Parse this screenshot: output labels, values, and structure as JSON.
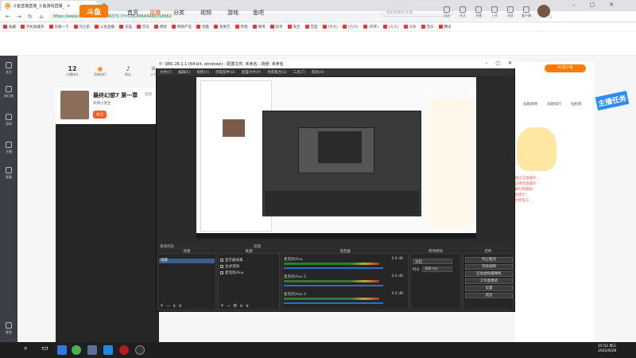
{
  "browser": {
    "tab_title": "斗鱼直播直播_斗鱼游戏直播_",
    "url": "https://www.douyu.com/5246371 /?=0.8149643445318662",
    "bookmarks": [
      "收藏",
      "手机收藏夹",
      "谷歌一下",
      "闪之航",
      "斗鱼直播",
      "天猫",
      "京东",
      "携程",
      "网易严选",
      "优酷",
      "爱奇艺",
      "哔哩",
      "微博",
      "知乎",
      "淘宝",
      "百度",
      "(大大)",
      "(六六)",
      "(开开)",
      "(人人)",
      "头条",
      "音乐",
      "腾讯"
    ]
  },
  "site": {
    "logo": "斗鱼",
    "nav": [
      "首页",
      "直播",
      "分类",
      "视频",
      "游戏",
      "鱼吧"
    ],
    "search_placeholder": "搜索直播间/主播",
    "header_icons": [
      "历史",
      "关注",
      "开播",
      "上传",
      "消息",
      "客户端"
    ],
    "sidebar": [
      "关注",
      "排行榜",
      "游戏",
      "主播",
      "赛事",
      "更多"
    ],
    "stats": [
      {
        "value": "12",
        "label": "主播排名"
      },
      {
        "value": "",
        "label": "贡献排行"
      },
      {
        "value": "",
        "label": "粉丝"
      },
      {
        "value": "",
        "label": "火力"
      }
    ],
    "room_title": "最终幻想7 第一章",
    "room_tag": "游戏",
    "anchor_name": "纯情小男生",
    "follow_label": "关注",
    "pc_client": "PC客户端",
    "right_tabs": [
      "贡献周榜",
      "贡献排行",
      "钻粉周"
    ],
    "promo_text": "主播任务",
    "chat_lines": [
      "主播正在直播中...",
      "欢迎来到直播间",
      "弹幕礼物播报",
      "斗鱼提示：",
      "请文明发言"
    ]
  },
  "obs": {
    "title": "OBS 26.1.1 (64-bit, windows) - 配置文件: 未命名 - 场景: 未命名",
    "menu": [
      "文件(F)",
      "编辑(E)",
      "视图(V)",
      "停靠部件(D)",
      "配置文件(P)",
      "场景集合(S)",
      "工具(T)",
      "帮助(H)"
    ],
    "scene_tabs": [
      "来源列表",
      "滤镜",
      "混音器"
    ],
    "docks": {
      "scenes": "场景",
      "sources": "来源",
      "mixer": "混音器",
      "transitions": "转场特效",
      "controls": "控件"
    },
    "scene_list": [
      "场景"
    ],
    "source_list": [
      "显示器采集",
      "台式音响",
      "麦克风/Aux"
    ],
    "mixer_rows": [
      {
        "name": "麦克风/Aux",
        "db": "0.0 dB"
      },
      {
        "name": "麦克风/Aux 2",
        "db": "0.0 dB"
      },
      {
        "name": "麦克风/Aux 3",
        "db": "0.0 dB"
      }
    ],
    "transition": {
      "type": "淡出",
      "duration_label": "时长",
      "duration": "300 ms"
    },
    "controls": [
      "停止推流",
      "开始录制",
      "启动虚拟摄像机",
      "工作室模式",
      "设置",
      "退出"
    ]
  },
  "taskbar": {
    "time": "15:52",
    "weekday": "周三",
    "date": "2022/6/28"
  }
}
